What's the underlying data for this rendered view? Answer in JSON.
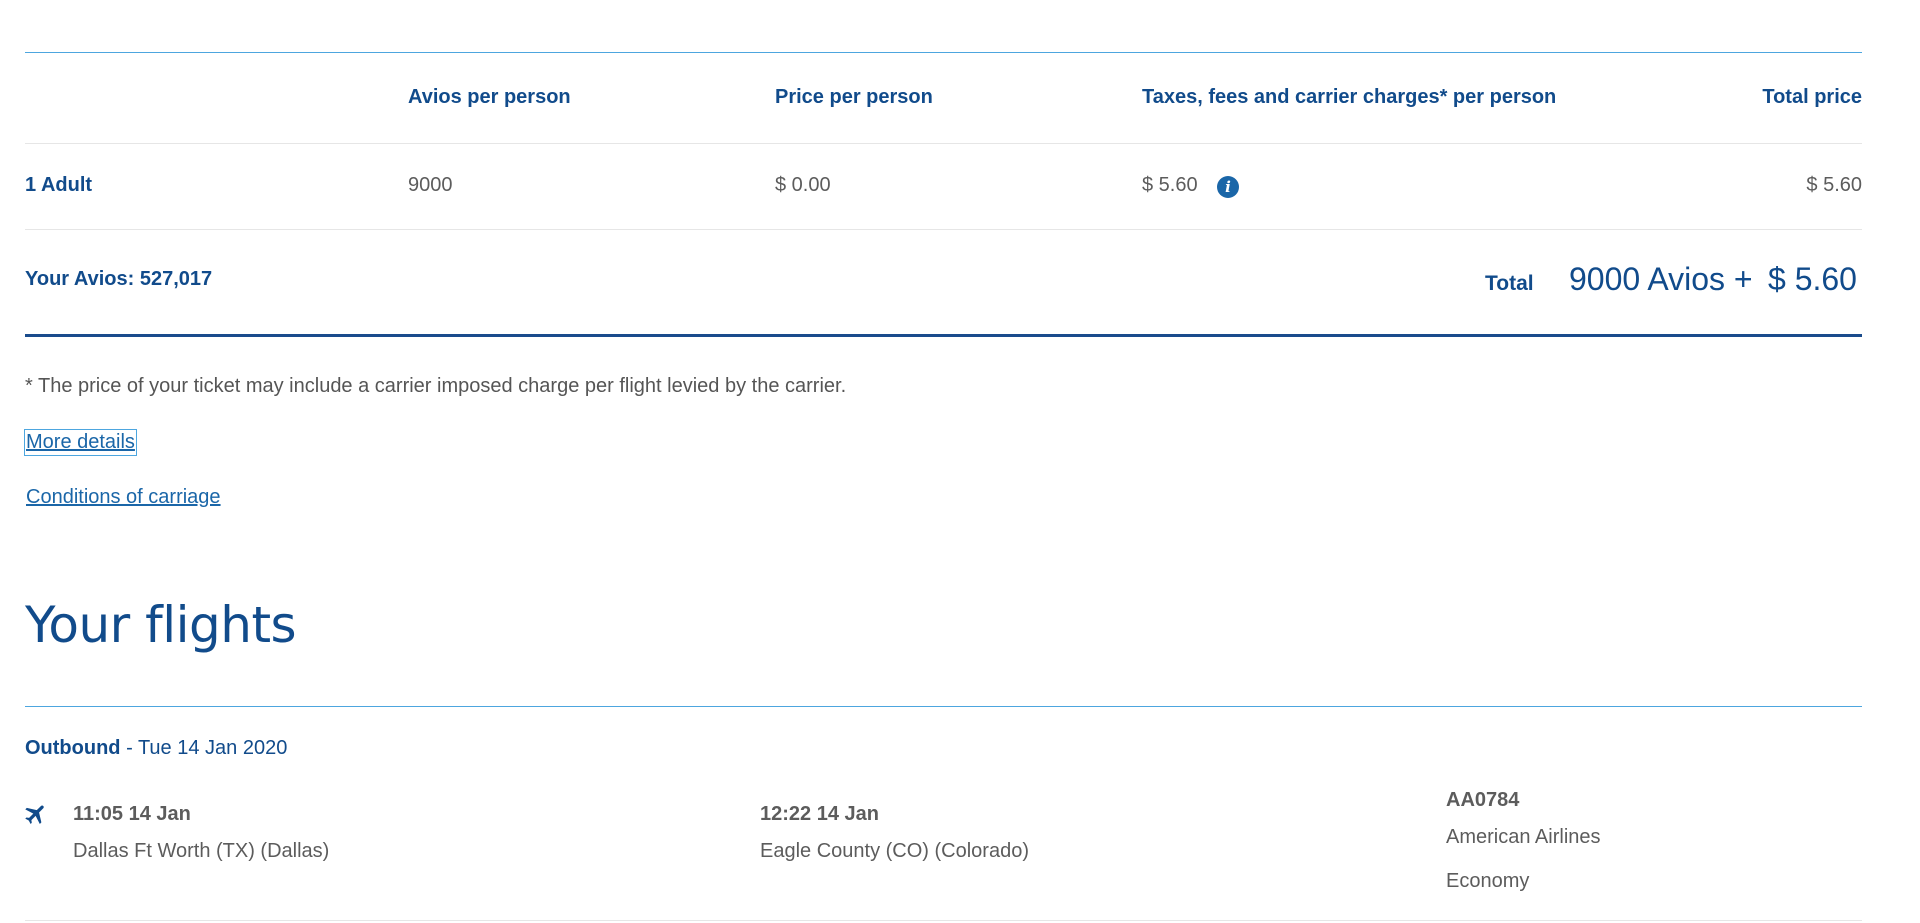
{
  "price_table": {
    "headers": {
      "avios": "Avios per person",
      "price": "Price per person",
      "taxes": "Taxes, fees and carrier charges* per person",
      "total": "Total price"
    },
    "row": {
      "passenger": "1 Adult",
      "avios": "9000",
      "price": "$ 0.00",
      "taxes": "$ 5.60",
      "total": "$ 5.60"
    },
    "your_avios": "Your Avios: 527,017",
    "total_label": "Total",
    "total_avios": "9000 Avios +",
    "total_cash": "$ 5.60"
  },
  "footnote": "* The price of your ticket may include a carrier imposed charge per flight levied by the carrier.",
  "links": {
    "more_details": "More details",
    "conditions": "Conditions of carriage"
  },
  "flights": {
    "title": "Your flights",
    "outbound_label": "Outbound",
    "outbound_date": " - Tue 14 Jan 2020",
    "segment": {
      "depart_time": "11:05 14 Jan",
      "depart_place": "Dallas Ft Worth (TX) (Dallas)",
      "arrive_time": "12:22 14 Jan",
      "arrive_place": "Eagle County (CO) (Colorado)",
      "flight_number": "AA0784",
      "airline": "American Airlines",
      "cabin": "Economy"
    }
  },
  "icons": {
    "info": "info-icon",
    "plane": "plane-icon"
  },
  "colors": {
    "navy": "#114b8b",
    "link": "#1a66a8",
    "rule_light": "#4da6df",
    "rule_dark": "#1a4b8c",
    "text": "#5c5c5c"
  }
}
